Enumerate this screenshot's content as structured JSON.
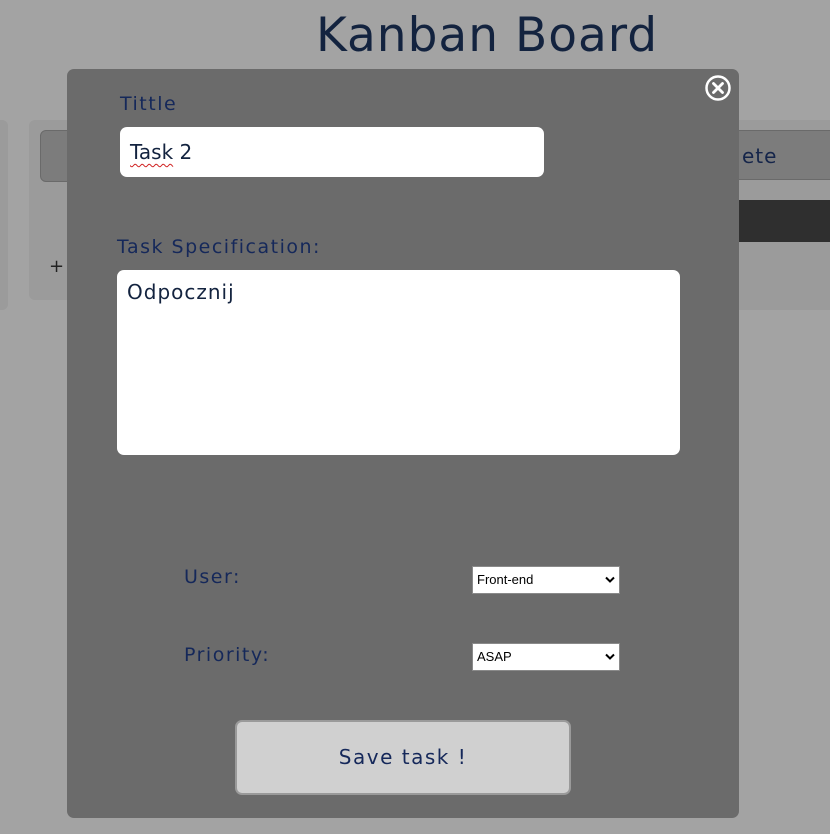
{
  "board": {
    "title": "Kanban Board",
    "add_symbol": "+",
    "right_column_header_fragment": "ete"
  },
  "modal": {
    "title_label": "Tittle",
    "title_value_first": "Task",
    "title_value_rest": " 2",
    "spec_label": "Task Specification:",
    "spec_value": "Odpocznij",
    "user_label": "User:",
    "user_selected": "Front-end",
    "priority_label": "Priority:",
    "priority_selected": "ASAP",
    "save_label": "Save task !",
    "close_icon": "close-circle-icon"
  },
  "colors": {
    "page_background": "#a3a3a3",
    "modal_background": "#6b6b6b",
    "title_text": "#13233f",
    "label_text": "#15285a",
    "save_button": "#d0d0d0"
  }
}
